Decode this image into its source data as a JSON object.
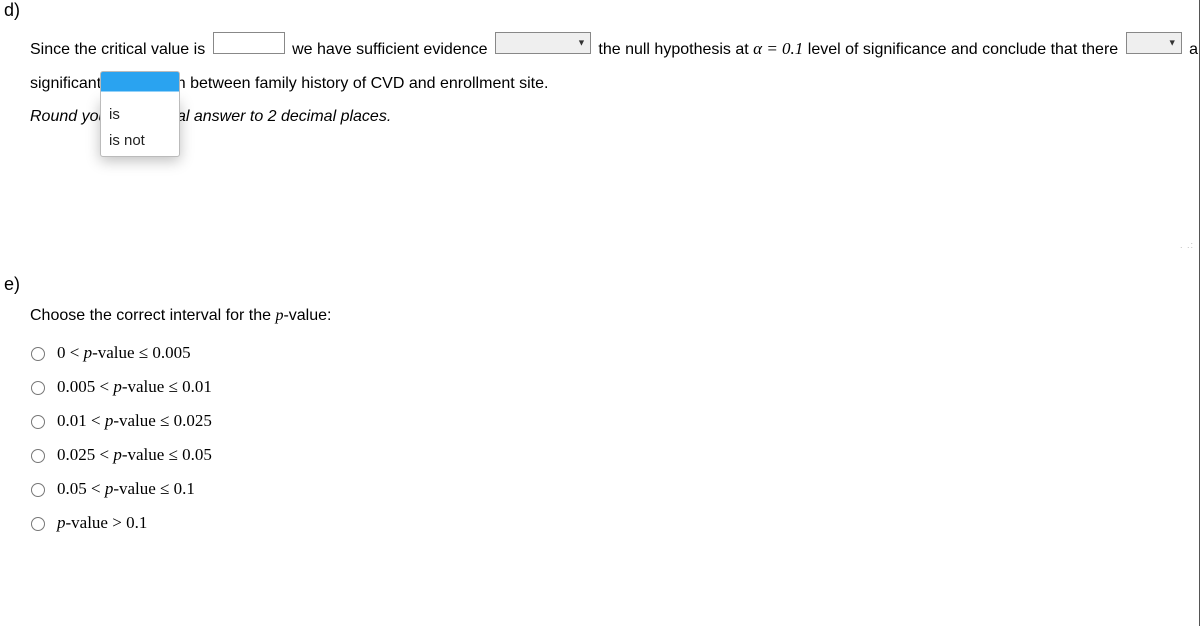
{
  "sectionD": {
    "label": "d)",
    "text1": "Since the critical value is",
    "text2": "we have sufficient evidence",
    "text3_before": "the null hypothesis at ",
    "alpha_eq": "α = 0.1",
    "text3_after": " level of significance and conclude that there",
    "text4": "a significant association between family history of CVD and enrollment site.",
    "roundHint_before": "Round you",
    "roundHint_after": "ical answer to 2 decimal places.",
    "dropdown_options": {
      "opt1": "is",
      "opt2": "is not"
    }
  },
  "sectionE": {
    "label": "e)",
    "prompt_before": "Choose the correct interval for the ",
    "prompt_p": "p",
    "prompt_after": "-value:",
    "options": {
      "o1": {
        "lhs": "0",
        "r1": "<",
        "mid_p": "p",
        "mid_txt": "-value",
        "r2": "≤",
        "rhs": "0.005"
      },
      "o2": {
        "lhs": "0.005",
        "r1": "<",
        "mid_p": "p",
        "mid_txt": "-value",
        "r2": "≤",
        "rhs": "0.01"
      },
      "o3": {
        "lhs": "0.01",
        "r1": "<",
        "mid_p": "p",
        "mid_txt": "-value",
        "r2": "≤",
        "rhs": "0.025"
      },
      "o4": {
        "lhs": "0.025",
        "r1": "<",
        "mid_p": "p",
        "mid_txt": "-value",
        "r2": "≤",
        "rhs": "0.05"
      },
      "o5": {
        "lhs": "0.05",
        "r1": "<",
        "mid_p": "p",
        "mid_txt": "-value",
        "r2": "≤",
        "rhs": "0.1"
      },
      "o6": {
        "mid_p": "p",
        "mid_txt": "-value",
        "r2": ">",
        "rhs": "0.1"
      }
    }
  }
}
